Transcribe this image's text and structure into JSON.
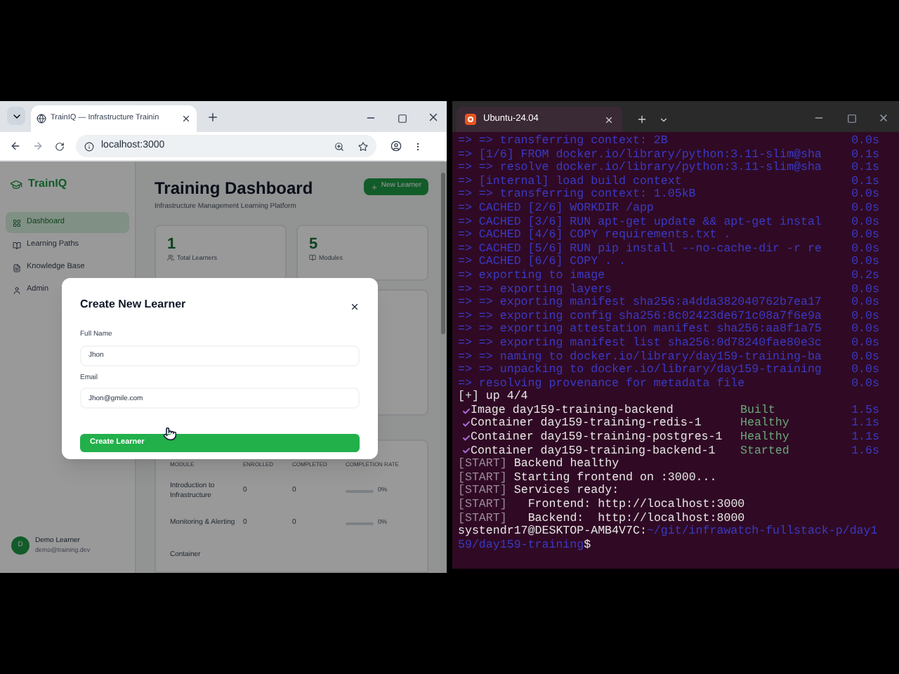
{
  "browser": {
    "tab": {
      "title": "TrainIQ — Infrastructure Trainin"
    },
    "address": "localhost:3000",
    "app": {
      "logo": "TrainIQ",
      "nav": [
        {
          "label": "Dashboard",
          "selected": true
        },
        {
          "label": "Learning Paths",
          "selected": false
        },
        {
          "label": "Knowledge Base",
          "selected": false
        },
        {
          "label": "Admin",
          "selected": false
        }
      ],
      "user": {
        "initial": "D",
        "name": "Demo Learner",
        "email": "demo@training.dev"
      },
      "title": "Training Dashboard",
      "subtitle": "Infrastructure Management Learning Platform",
      "new_button": "New Learner",
      "stats": [
        {
          "value": "1",
          "label": "Total Learners"
        },
        {
          "value": "5",
          "label": "Modules"
        }
      ],
      "table": {
        "columns": [
          "MODULE",
          "ENROLLED",
          "COMPLETED",
          "COMPLETION RATE"
        ],
        "rows": [
          {
            "module": "Introduction to Infrastructure",
            "enrolled": "0",
            "completed": "0",
            "rate": "0%",
            "level": 0
          },
          {
            "module": "Monitoring & Alerting",
            "enrolled": "0",
            "completed": "0",
            "rate": "0%",
            "level": 0
          },
          {
            "module": "Container"
          }
        ]
      }
    },
    "dialog": {
      "title": "Create New Learner",
      "fields": [
        {
          "label": "Full Name",
          "value": "Jhon"
        },
        {
          "label": "Email",
          "value": "Jhon@gmile.com"
        }
      ],
      "submit": "Create Learner"
    }
  },
  "terminal": {
    "tab": {
      "title": "Ubuntu-24.04"
    },
    "lines": [
      {
        "kind": "build",
        "text": "=> => transferring context: 2B",
        "time": "0.0s"
      },
      {
        "kind": "build",
        "text": "=> [1/6] FROM docker.io/library/python:3.11-slim@sha",
        "time": "0.1s"
      },
      {
        "kind": "build",
        "text": "=> => resolve docker.io/library/python:3.11-slim@sha",
        "time": "0.1s"
      },
      {
        "kind": "build",
        "text": "=> [internal] load build context",
        "time": "0.1s"
      },
      {
        "kind": "build",
        "text": "=> => transferring context: 1.05kB",
        "time": "0.0s"
      },
      {
        "kind": "build",
        "text": "=> CACHED [2/6] WORKDIR /app",
        "time": "0.0s"
      },
      {
        "kind": "build",
        "text": "=> CACHED [3/6] RUN apt-get update && apt-get instal",
        "time": "0.0s"
      },
      {
        "kind": "build",
        "text": "=> CACHED [4/6] COPY requirements.txt .",
        "time": "0.0s"
      },
      {
        "kind": "build",
        "text": "=> CACHED [5/6] RUN pip install --no-cache-dir -r re",
        "time": "0.0s"
      },
      {
        "kind": "build",
        "text": "=> CACHED [6/6] COPY . .",
        "time": "0.0s"
      },
      {
        "kind": "build",
        "text": "=> exporting to image",
        "time": "0.2s"
      },
      {
        "kind": "build",
        "text": "=> => exporting layers",
        "time": "0.0s"
      },
      {
        "kind": "build",
        "text": "=> => exporting manifest sha256:a4dda382040762b7ea17",
        "time": "0.0s"
      },
      {
        "kind": "build",
        "text": "=> => exporting config sha256:8c02423de671c08a7f6e9a",
        "time": "0.0s"
      },
      {
        "kind": "build",
        "text": "=> => exporting attestation manifest sha256:aa8f1a75",
        "time": "0.0s"
      },
      {
        "kind": "build",
        "text": "=> => exporting manifest list sha256:0d78240fae80e3c",
        "time": "0.0s"
      },
      {
        "kind": "build",
        "text": "=> => naming to docker.io/library/day159-training-ba",
        "time": "0.0s"
      },
      {
        "kind": "build",
        "text": "=> => unpacking to docker.io/library/day159-training",
        "time": "0.0s"
      },
      {
        "kind": "build",
        "text": "=> resolving provenance for metadata file",
        "time": "0.0s"
      },
      {
        "kind": "plain",
        "text": "[+] up 4/4"
      },
      {
        "kind": "service",
        "text": "Image day159-training-backend",
        "status": "Built",
        "time": "1.5s"
      },
      {
        "kind": "service",
        "text": "Container day159-training-redis-1",
        "status": "Healthy",
        "time": "1.1s"
      },
      {
        "kind": "service",
        "text": "Container day159-training-postgres-1",
        "status": "Healthy",
        "time": "1.1s"
      },
      {
        "kind": "service",
        "text": "Container day159-training-backend-1",
        "status": "Started",
        "time": "1.6s"
      },
      {
        "kind": "log",
        "tag": "[START]",
        "text": "Backend healthy"
      },
      {
        "kind": "log",
        "tag": "[START]",
        "text": "Starting frontend on :3000..."
      },
      {
        "kind": "log",
        "tag": "[START]",
        "text": "Services ready:"
      },
      {
        "kind": "log",
        "tag": "[START]",
        "text": "  Frontend: http://localhost:3000"
      },
      {
        "kind": "log",
        "tag": "[START]",
        "text": "  Backend:  http://localhost:8000"
      },
      {
        "kind": "prompt",
        "user": "systendr17@DESKTOP-AMB4V7C",
        "sep": ":",
        "path": "~/git/infrawatch-fullstack-p/day159/day159-training",
        "symbol": "$"
      }
    ]
  }
}
